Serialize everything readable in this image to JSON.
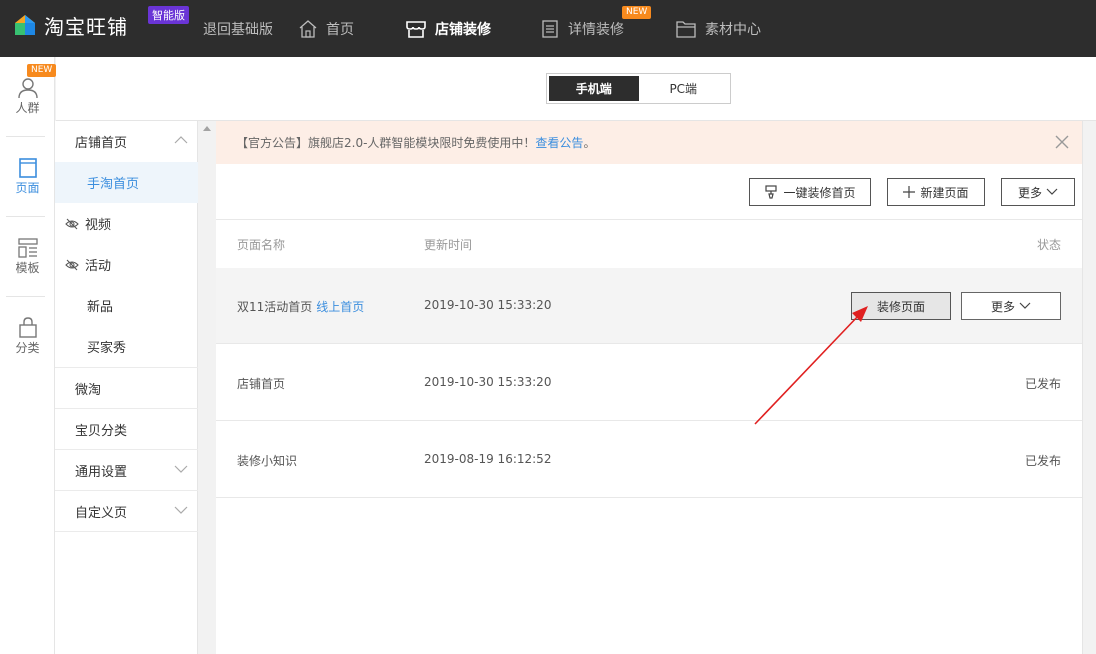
{
  "topbar": {
    "logo_text": "淘宝旺铺",
    "edition_badge": "智能版",
    "nav": [
      {
        "label": "退回基础版",
        "icon": "none"
      },
      {
        "label": "首页",
        "icon": "home-icon"
      },
      {
        "label": "店铺装修",
        "icon": "store-icon",
        "active": true
      },
      {
        "label": "详情装修",
        "icon": "detail-icon",
        "tag": "NEW"
      },
      {
        "label": "素材中心",
        "icon": "folder-icon"
      }
    ]
  },
  "rail": [
    {
      "label": "人群",
      "icon": "user-icon",
      "tag": "NEW"
    },
    {
      "label": "页面",
      "icon": "page-icon",
      "active": true
    },
    {
      "label": "模板",
      "icon": "template-icon"
    },
    {
      "label": "分类",
      "icon": "bag-icon"
    }
  ],
  "device_switch": {
    "mobile": "手机端",
    "pc": "PC端",
    "selected": "mobile"
  },
  "menu": [
    {
      "label": "店铺首页",
      "level": "top",
      "chevron": "up"
    },
    {
      "label": "手淘首页",
      "level": "sub",
      "selected": true
    },
    {
      "label": "视频",
      "level": "top",
      "hidden_icon": true
    },
    {
      "label": "活动",
      "level": "top",
      "hidden_icon": true
    },
    {
      "label": "新品",
      "level": "sub"
    },
    {
      "label": "买家秀",
      "level": "sub"
    },
    {
      "label": "微淘",
      "level": "top"
    },
    {
      "label": "宝贝分类",
      "level": "top"
    },
    {
      "label": "通用设置",
      "level": "top",
      "chevron": "down"
    },
    {
      "label": "自定义页",
      "level": "top",
      "chevron": "down"
    }
  ],
  "notice": {
    "text": "【官方公告】旗舰店2.0-人群智能模块限时免费使用中！",
    "link": "查看公告",
    "suffix": "。"
  },
  "toolbar": {
    "one_click": "一键装修首页",
    "new_page": "新建页面",
    "more": "更多"
  },
  "table": {
    "headers": {
      "name": "页面名称",
      "time": "更新时间",
      "status": "状态"
    },
    "rows": [
      {
        "name": "双11活动首页",
        "link": "线上首页",
        "time": "2019-10-30 15:33:20",
        "status": "",
        "action": "装修页面",
        "more": "更多"
      },
      {
        "name": "店铺首页",
        "link": "",
        "time": "2019-10-30 15:33:20",
        "status": "已发布"
      },
      {
        "name": "装修小知识",
        "link": "",
        "time": "2019-08-19 16:12:52",
        "status": "已发布"
      }
    ]
  },
  "colors": {
    "accent": "#3b8ede",
    "topbar": "#2d2d2d",
    "notice_bg": "#fdeee6",
    "arrow": "#e02020"
  }
}
